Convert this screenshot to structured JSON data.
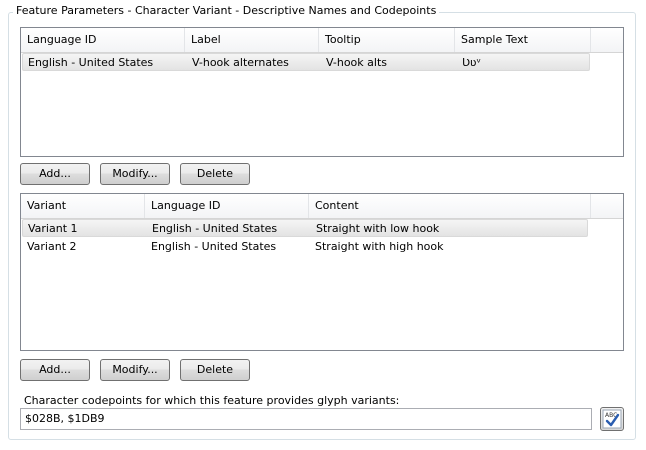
{
  "group": {
    "title": "Feature Parameters - Character Variant - Descriptive Names and Codepoints"
  },
  "names_table": {
    "columns": [
      "Language ID",
      "Label",
      "Tooltip",
      "Sample Text"
    ],
    "rows": [
      [
        "English - United States",
        "V-hook alternates",
        "V-hook alts",
        "Ʋʋᵛ"
      ]
    ],
    "selected_row": 0
  },
  "names_buttons": {
    "add": "Add...",
    "modify": "Modify...",
    "delete": "Delete"
  },
  "variants_table": {
    "columns": [
      "Variant",
      "Language ID",
      "Content"
    ],
    "rows": [
      [
        "Variant 1",
        "English - United States",
        "Straight with low hook"
      ],
      [
        "Variant 2",
        "English - United States",
        "Straight with high hook"
      ]
    ],
    "selected_row": 0
  },
  "variants_buttons": {
    "add": "Add...",
    "modify": "Modify...",
    "delete": "Delete"
  },
  "codepoints": {
    "label": "Character codepoints for which this feature provides glyph variants:",
    "value": "$028B, $1DB9",
    "spellcheck_icon": "abc-check-icon"
  },
  "colors": {
    "border": "#828790",
    "selection": "#e3e3e3",
    "check_blue": "#2a5db0"
  }
}
